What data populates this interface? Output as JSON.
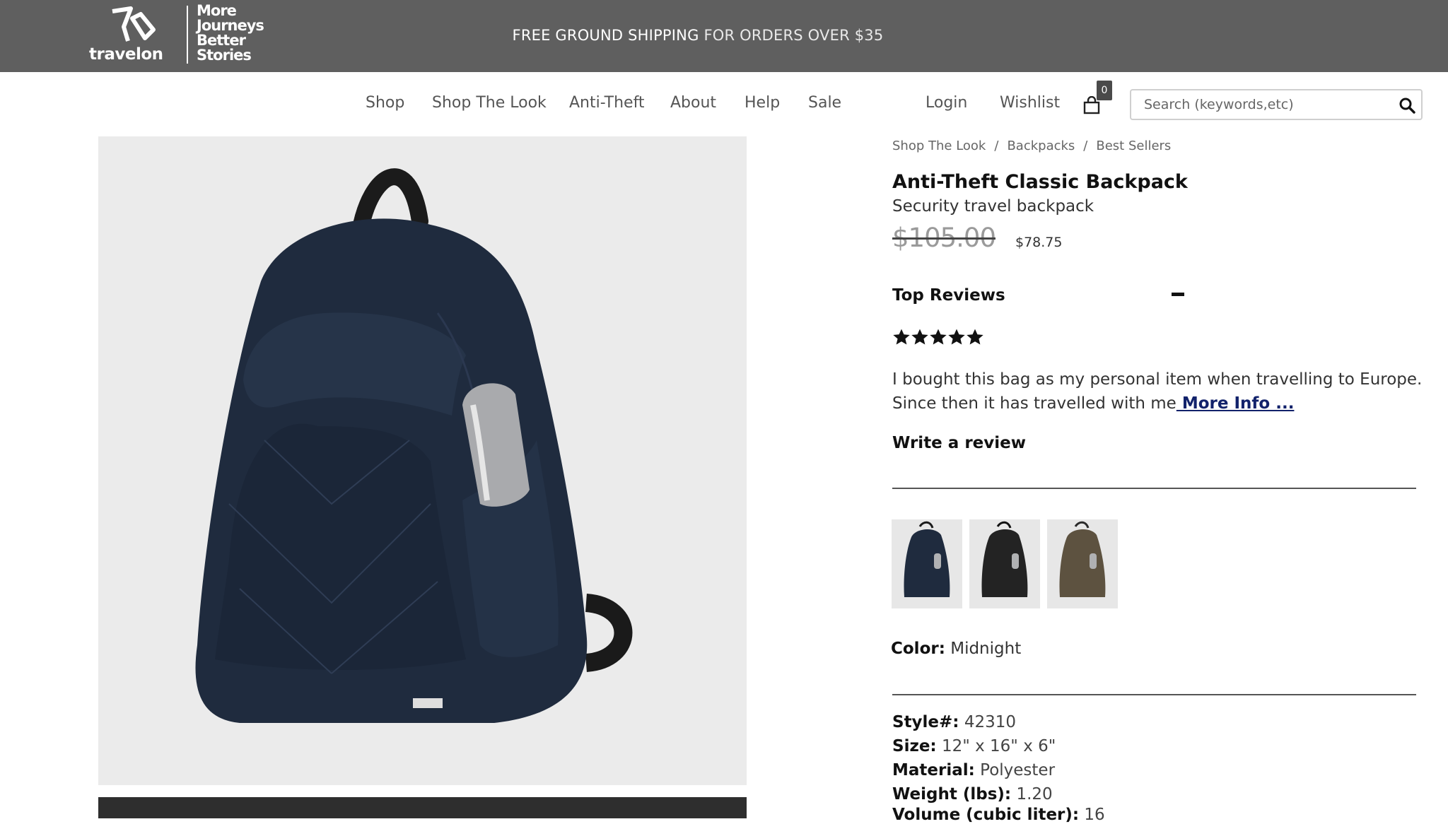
{
  "brand": {
    "wordmark": "travelon",
    "tagline": [
      "More",
      "Journeys",
      "Better",
      "Stories"
    ]
  },
  "promo": {
    "bold": "FREE GROUND SHIPPING",
    "rest": " FOR ORDERS OVER $35"
  },
  "nav": {
    "items": [
      "Shop",
      "Shop The Look",
      "Anti-Theft",
      "About",
      "Help",
      "Sale"
    ],
    "login": "Login",
    "wishlist": "Wishlist",
    "cart_count": "0",
    "search_placeholder": "Search (keywords,etc)"
  },
  "breadcrumb": [
    "Shop The Look",
    "Backpacks",
    "Best Sellers"
  ],
  "product": {
    "title": "Anti-Theft Classic Backpack",
    "subtitle": "Security travel backpack",
    "price_original": "$105.00",
    "price_sale": "$78.75"
  },
  "reviews": {
    "heading": "Top Reviews",
    "rating": 5,
    "max_rating": 5,
    "text": "I bought this bag as my personal item when travelling to Europe. Since then it has travelled with me",
    "more_link": " More Info ...",
    "write_label": "Write a review"
  },
  "swatches": [
    {
      "color": "#1f2b3e"
    },
    {
      "color": "#232323"
    },
    {
      "color": "#5d5240"
    }
  ],
  "color": {
    "label": "Color:",
    "value": "Midnight"
  },
  "specs": [
    {
      "label": "Style#:",
      "value": "42310"
    },
    {
      "label": "Size:",
      "value": "12\" x 16\" x 6\""
    },
    {
      "label": "Material:",
      "value": "Polyester"
    },
    {
      "label": "Weight (lbs):",
      "value": "1.20"
    },
    {
      "label": "Volume (cubic liter):",
      "value": "16"
    }
  ],
  "colors": {
    "promo_bg": "#5f5f5f",
    "link": "#12226b",
    "bag": "#1f2b3e"
  }
}
